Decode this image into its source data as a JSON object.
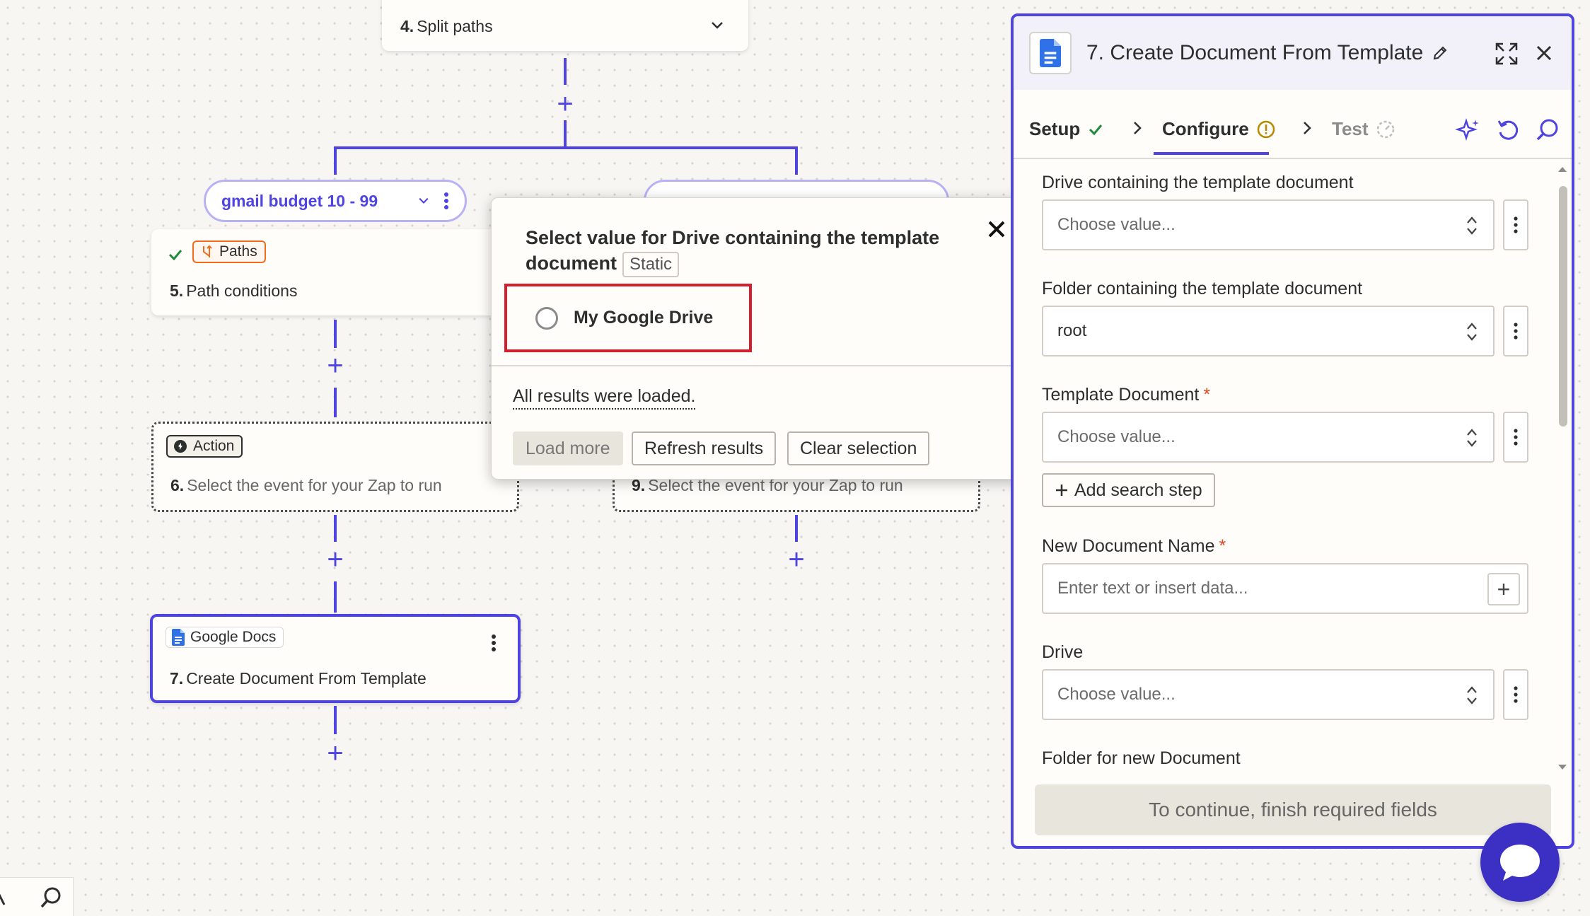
{
  "canvas": {
    "split_node": {
      "step": "4.",
      "title": "Split paths"
    },
    "path_a": {
      "label": "gmail budget 10 - 99"
    },
    "path_b": {
      "label": ""
    },
    "paths_card": {
      "chip": "Paths",
      "step": "5.",
      "title": "Path conditions"
    },
    "action_card": {
      "chip": "Action",
      "step": "6.",
      "title": "Select the event for your Zap to run"
    },
    "action_card_b": {
      "step": "9.",
      "title": "Select the event for your Zap to run"
    },
    "docs_card": {
      "chip": "Google Docs",
      "step": "7.",
      "title": "Create Document From Template"
    }
  },
  "popup": {
    "title": "Select value for Drive containing the template document",
    "badge": "Static",
    "option": "My Google Drive",
    "status": "All results were loaded.",
    "buttons": {
      "load_more": "Load more",
      "refresh": "Refresh results",
      "clear": "Clear selection"
    }
  },
  "panel": {
    "title": "7. Create Document From Template",
    "tabs": {
      "setup": "Setup",
      "configure": "Configure",
      "test": "Test"
    },
    "fields": {
      "drive_template": {
        "label": "Drive containing the template document",
        "placeholder": "Choose value..."
      },
      "folder_template": {
        "label": "Folder containing the template document",
        "value": "root"
      },
      "template_doc": {
        "label": "Template Document",
        "placeholder": "Choose value..."
      },
      "add_search_step": "Add search step",
      "new_doc_name": {
        "label": "New Document Name",
        "placeholder": "Enter text or insert data..."
      },
      "drive": {
        "label": "Drive",
        "placeholder": "Choose value..."
      },
      "folder_new": {
        "label": "Folder for new Document"
      }
    },
    "continue": "To continue, finish required fields"
  },
  "colors": {
    "accent": "#4f44e0",
    "highlight": "#d4202e",
    "paths": "#ef6b1d"
  }
}
